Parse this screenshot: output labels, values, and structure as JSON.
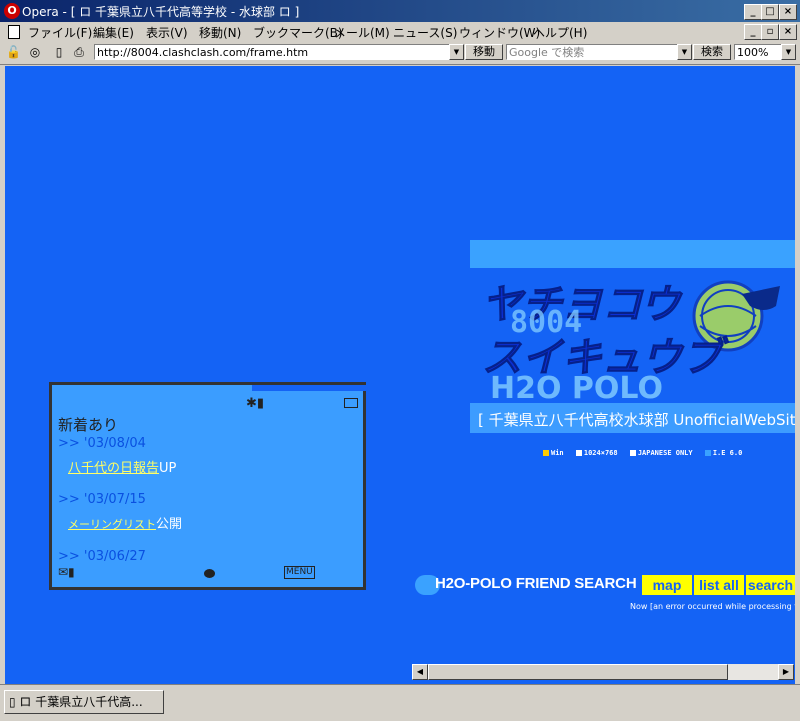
{
  "window": {
    "title": "Opera - [ ロ 千葉県立八千代高等学校 - 水球部 ロ ]"
  },
  "menu": [
    "ファイル(F)",
    "編集(E)",
    "表示(V)",
    "移動(N)",
    "ブックマーク(B)",
    "メール(M)",
    "ニュース(S)",
    "ウィンドウ(W)",
    "ヘルプ(H)"
  ],
  "address": {
    "url": "http://8004.clashclash.com/frame.htm",
    "go_label": "移動",
    "search_placeholder": "Google で検索",
    "search_label": "検索",
    "zoom": "100%"
  },
  "site": {
    "logo_text": [
      "ヤチヨコウ",
      "8004",
      "スイキュウブ",
      "H2O POLO"
    ],
    "subtitle": "[ 千葉県立八千代高校水球部 UnofficialWebSite",
    "specs": [
      "Win",
      "1024×768",
      "JAPANESE ONLY",
      "I.E 6.0"
    ],
    "friend_search": {
      "title": "H2O-POLO FRIEND SEARCH",
      "buttons": [
        "map",
        "list all",
        "search"
      ],
      "status": "Now [an error occurred while processing t"
    }
  },
  "phone": {
    "heading": "新着あり",
    "entries": [
      {
        "date": ">> '03/08/04",
        "link": "八千代の日報告",
        "suffix": "UP"
      },
      {
        "date": ">> '03/07/15",
        "link": "メーリングリスト",
        "suffix": "公開"
      },
      {
        "date": ">> '03/06/27",
        "link": "",
        "suffix": ""
      }
    ],
    "menu_label": "MENU"
  },
  "taskbar": {
    "item": "ロ 千葉県立八千代高..."
  }
}
